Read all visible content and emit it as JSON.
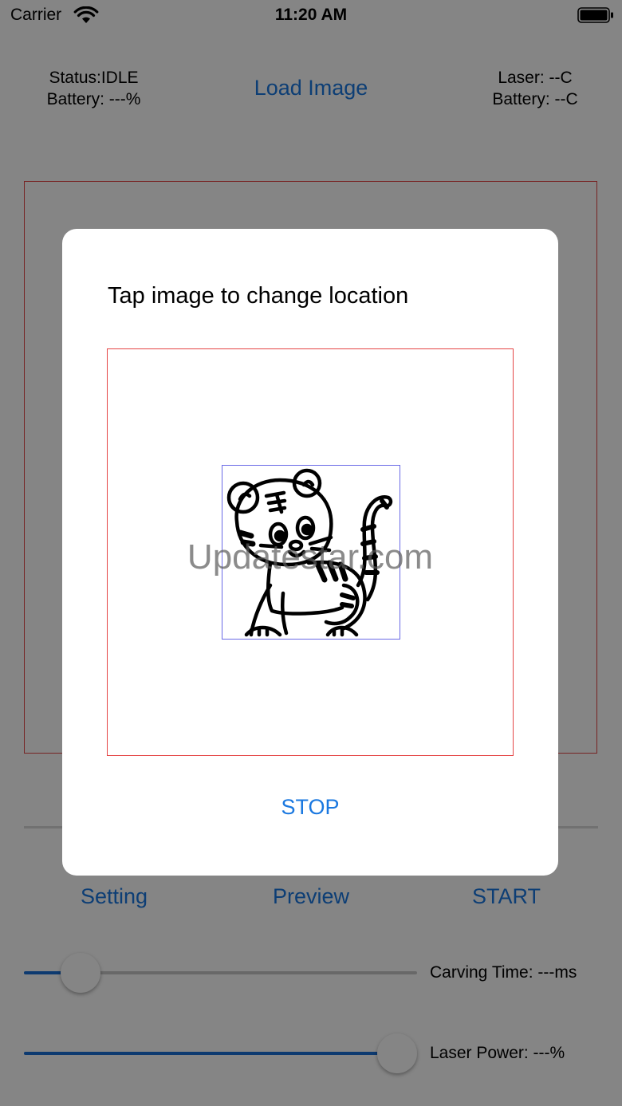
{
  "status_bar": {
    "carrier": "Carrier",
    "time": "11:20 AM",
    "icons": [
      "wifi-icon",
      "battery-icon"
    ]
  },
  "header": {
    "status": "Status:IDLE",
    "battery_left": "Battery: ---%",
    "load_image": "Load Image",
    "laser": "Laser: --C",
    "battery_right": "Battery: --C"
  },
  "dialog": {
    "title": "Tap image to change location",
    "watermark": "Updatestar.com",
    "image_icon": "tiger-illustration",
    "stop_label": "STOP"
  },
  "buttons": {
    "setting": "Setting",
    "preview": "Preview",
    "start": "START"
  },
  "sliders": {
    "carving_time": {
      "label": "Carving Time: ---ms",
      "value_fraction": 0.14
    },
    "laser_power": {
      "label": "Laser Power: ---%",
      "value_fraction": 0.95
    }
  },
  "colors": {
    "accent": "#1a78e0",
    "frame": "#e54545",
    "image_border": "#6a6ae6",
    "slider_fill": "#1a6fd6"
  }
}
